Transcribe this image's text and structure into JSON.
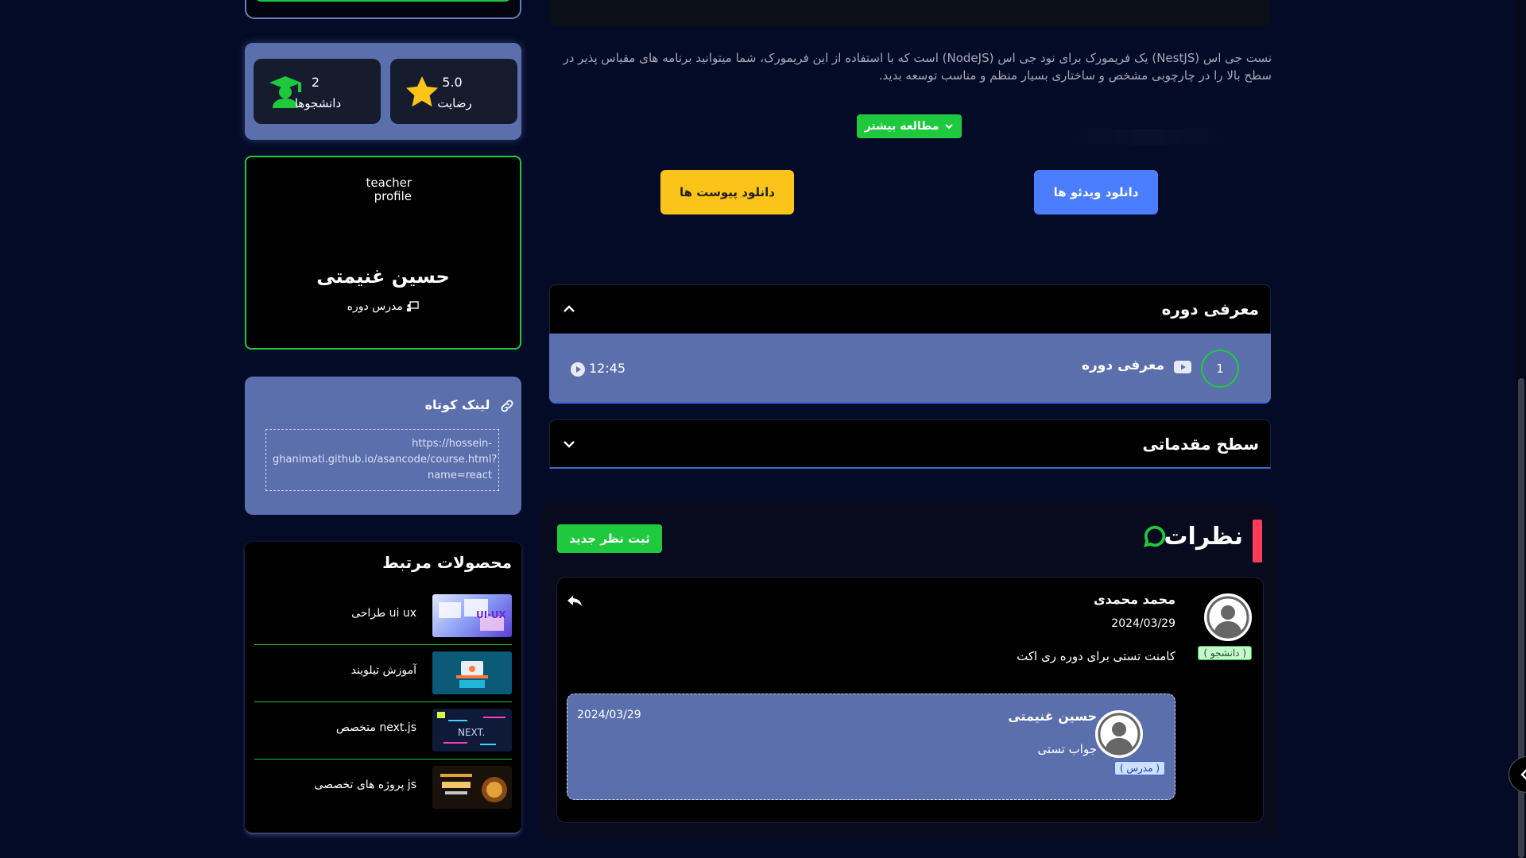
{
  "stats": {
    "rating_value": "5.0",
    "rating_label": "رضایت",
    "students_value": "2",
    "students_label": "دانشجوها"
  },
  "teacher": {
    "image_alt": "teacher profile",
    "name": "حسین غنیمتی",
    "role": "مدرس دوره"
  },
  "short_link": {
    "title": "لینک کوتاه",
    "url": "https://hossein-ghanimati.github.io/asancode/course.html?name=react"
  },
  "related": {
    "title": "محصولات مرتبط",
    "items": [
      {
        "label": "طراحی ui ux"
      },
      {
        "label": "آموزش تیلویند"
      },
      {
        "label": "متخصص next.js"
      },
      {
        "label": "پروژه های تخصصی js"
      }
    ]
  },
  "course": {
    "description": "نست جی اس (NestJS) یک فریمورک برای نود جی اس (NodeJS) است که با استفاده از این فریمورک، شما میتوانید برنامه های مقیاس پذیر در سطح بالا را در چارچوبی مشخص و ساختاری بسیار منظم و مناسب توسعه بدید.",
    "read_more": "مطالعه بیشتر",
    "download_files": "دانلود پیوست ها",
    "download_videos": "دانلود ویدئو ها"
  },
  "sections": [
    {
      "title": "معرفی دوره",
      "expanded": true,
      "lessons": [
        {
          "number": "1",
          "title": "معرفی دوره",
          "duration": "12:45"
        }
      ]
    },
    {
      "title": "سطح مقدماتی",
      "expanded": false
    }
  ],
  "comments": {
    "title": "نظرات",
    "new_button": "ثبت نظر جدید",
    "items": [
      {
        "author": "محمد محمدی",
        "date": "2024/03/29",
        "role_badge": "( دانشجو )",
        "text": "کامنت تستی برای دوره ری اکت",
        "reply": {
          "author": "حسین غنیمتی",
          "date": "2024/03/29",
          "role_badge": "( مدرس )",
          "text": "جواب تستی"
        }
      }
    ]
  },
  "colors": {
    "background": "#040b26",
    "accent_green": "#1fc93e",
    "card_blue": "#5b6fac",
    "button_yellow": "#fcc419",
    "button_blue": "#4a7dff",
    "comments_accent": "#ff3d5a"
  }
}
